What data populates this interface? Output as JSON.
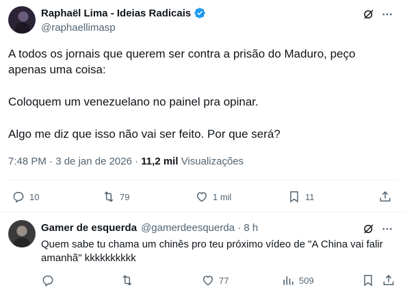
{
  "tweet": {
    "author_name": "Raphaël Lima - Ideias Radicais",
    "handle": "@raphaellimasp",
    "line1": "A todos os jornais que querem ser contra a prisão do Maduro, peço apenas uma coisa:",
    "line2": "Coloquem um venezuelano no painel pra opinar.",
    "line3": "Algo me diz que isso não vai ser feito. Por que será?",
    "time": "7:48 PM · 3 de jan de 2026 · ",
    "views_count": "11,2 mil",
    "views_label": "Visualizações",
    "replies": "10",
    "reposts": "79",
    "likes": "1 mil",
    "bookmarks": "11"
  },
  "reply": {
    "author_name": "Gamer de esquerda",
    "handle_time": "@gamerdeesquerda · 8 h",
    "text": "Quem sabe tu chama um chinês pro teu próximo vídeo de \"A China vai falir amanhã\" kkkkkkkkkk",
    "likes": "77",
    "views": "509"
  },
  "colors": {
    "verified": "#1d9bf0",
    "muted": "#536471",
    "text": "#0f1419"
  }
}
